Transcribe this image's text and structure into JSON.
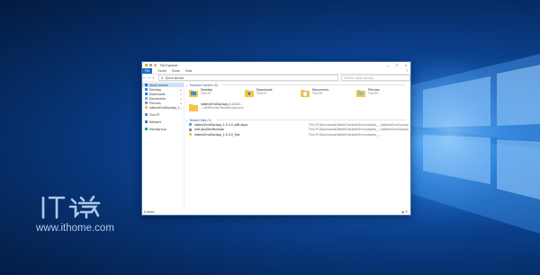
{
  "window": {
    "title": "File Explorer",
    "controls": {
      "minimize": "—",
      "maximize": "☐",
      "close": "✕"
    }
  },
  "ribbon": {
    "file_tab": "File",
    "tabs": [
      "Home",
      "Share",
      "View"
    ],
    "help": "?"
  },
  "address": {
    "back": "←",
    "forward": "→",
    "up": "↑",
    "path": "Quick access",
    "search_placeholder": "Search Quick access"
  },
  "sidebar": {
    "items": [
      {
        "label": "Quick access",
        "selected": true
      },
      {
        "label": "Desktop",
        "pinned": true
      },
      {
        "label": "Downloads",
        "pinned": true
      },
      {
        "label": "Documents",
        "pinned": true
      },
      {
        "label": "Pictures",
        "pinned": true
      },
      {
        "label": "IotbestOneDayApp_1..."
      },
      {
        "label": "This PC"
      },
      {
        "label": "Network"
      },
      {
        "label": "Homegroup"
      }
    ]
  },
  "frequent": {
    "header": "Frequent folders (5)",
    "folders": [
      {
        "name": "Desktop",
        "sub": "This PC"
      },
      {
        "name": "Downloads",
        "sub": "This PC"
      },
      {
        "name": "Documents",
        "sub": "This PC"
      },
      {
        "name": "Pictures",
        "sub": "This PC"
      },
      {
        "name": "IotbestOneDayApp_1.0.0.0...",
        "sub": "...\\AMSE\\interfaceBackground"
      }
    ]
  },
  "recent": {
    "header": "Recent files (3)",
    "files": [
      {
        "name": "IotbestOneDayApp_1.0.0.0_x86.appx",
        "path": "This PC\\Downloads\\WebKit\\IotbestTechnologies_...\\IotbestOneDayApp_1.0.0.0_Test\\"
      },
      {
        "name": "Add-AppDevPackage",
        "path": "This PC\\Downloads\\WebKit\\IotbestTechnologies_...\\IotbestOneDayApp_1.0.0.0_Test\\"
      },
      {
        "name": "IotbestOneDayApp_1.0.0.0_Test",
        "path": "This PC\\Downloads\\WebKit\\IotbestTechnologies_..."
      }
    ]
  },
  "status": {
    "items": "8 items"
  },
  "watermark": {
    "logo": "IT之家",
    "url": "www.ithome.com"
  },
  "colors": {
    "accent": "#1a6ed0",
    "folder": "#f5c542"
  }
}
